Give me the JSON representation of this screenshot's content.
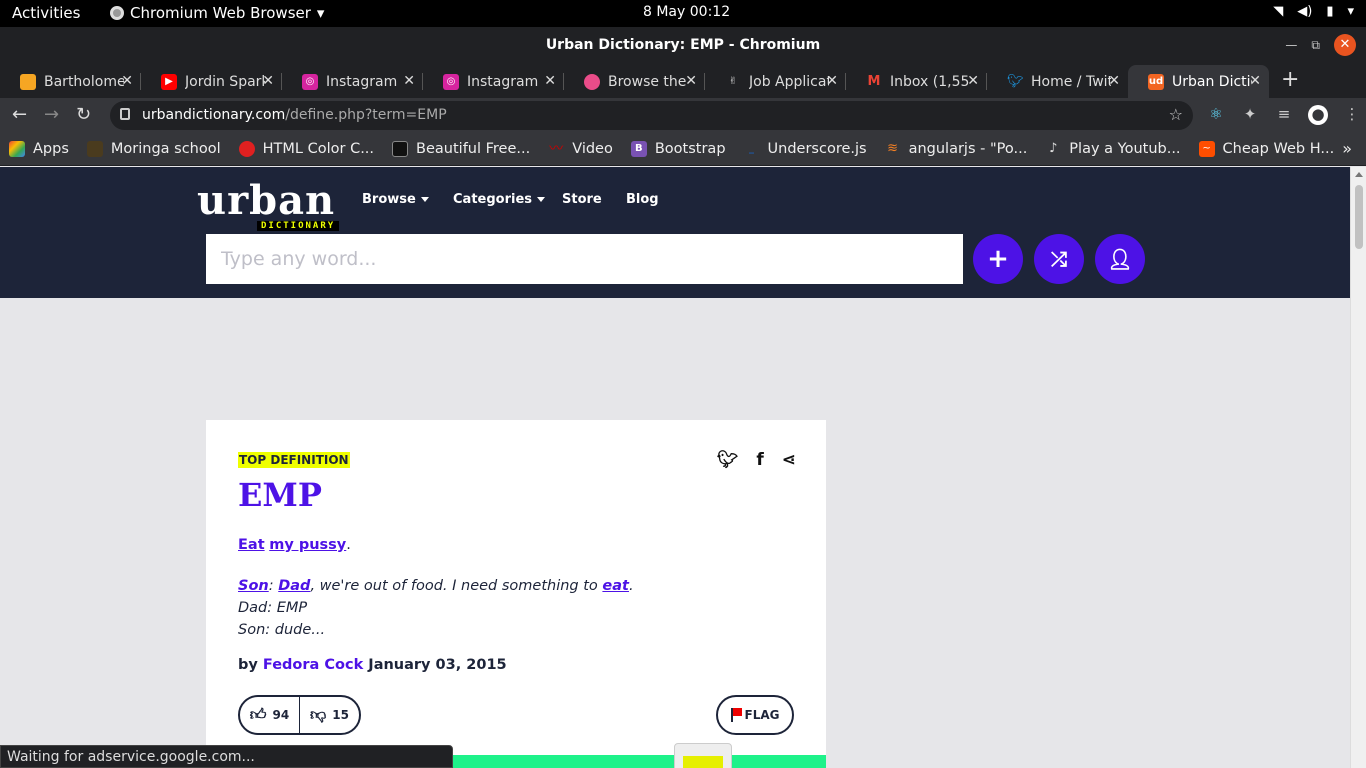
{
  "system": {
    "activities": "Activities",
    "app_name": "Chromium Web Browser",
    "clock": "8 May  00:12"
  },
  "window": {
    "title": "Urban Dictionary: EMP - Chromium"
  },
  "tabs": [
    {
      "label": "Bartholomew",
      "color": "#f6a623"
    },
    {
      "label": "Jordin Sparks",
      "color": "#ff0000"
    },
    {
      "label": "Instagram",
      "color": "#d6249f"
    },
    {
      "label": "Instagram",
      "color": "#d6249f"
    },
    {
      "label": "Browse the",
      "color": "#ea4c89"
    },
    {
      "label": "Job Applicat",
      "color": "#555555"
    },
    {
      "label": "Inbox (1,55",
      "color": "#ea4335"
    },
    {
      "label": "Home / Twit",
      "color": "#1da1f2"
    },
    {
      "label": "Urban Dictio",
      "color": "#f26522",
      "active": true
    }
  ],
  "address": {
    "domain": "urbandictionary.com",
    "path": "/define.php?term=EMP"
  },
  "bookmarks": [
    {
      "label": "Apps",
      "color": "#4285f4"
    },
    {
      "label": "Moringa school",
      "color": "#4a3b1e"
    },
    {
      "label": "HTML Color C...",
      "color": "#e02020"
    },
    {
      "label": "Beautiful Free...",
      "color": "#111111"
    },
    {
      "label": "Video",
      "color": "#cc0000"
    },
    {
      "label": "Bootstrap",
      "color": "#7952b3"
    },
    {
      "label": "Underscore.js",
      "color": "#1a5fb4"
    },
    {
      "label": "angularjs - \"Po...",
      "color": "#f48024"
    },
    {
      "label": "Play a Youtub...",
      "color": "#333333"
    },
    {
      "label": "Cheap Web H...",
      "color": "#ff4e00"
    }
  ],
  "site": {
    "logo": "urban",
    "logo_sub": "DICTIONARY",
    "nav": {
      "browse": "Browse",
      "categories": "Categories",
      "store": "Store",
      "blog": "Blog"
    },
    "search_placeholder": "Type any word...",
    "accent": "#4d12e6",
    "header_bg": "#1d2439"
  },
  "definition": {
    "label": "TOP DEFINITION",
    "word": "EMP",
    "meaning_parts": [
      "Eat",
      "my pussy",
      "."
    ],
    "example": {
      "speaker1": "Son",
      "speaker2": "Dad",
      "line1_rest": ", we're out of food. I need something to",
      "link": "eat",
      "line2": "Dad: EMP",
      "line3": "Son: dude..."
    },
    "by": "by",
    "author": "Fedora Cock",
    "date": "January 03, 2015",
    "upvotes": "94",
    "downvotes": "15",
    "flag": "FLAG"
  },
  "status": "Waiting for adservice.google.com..."
}
